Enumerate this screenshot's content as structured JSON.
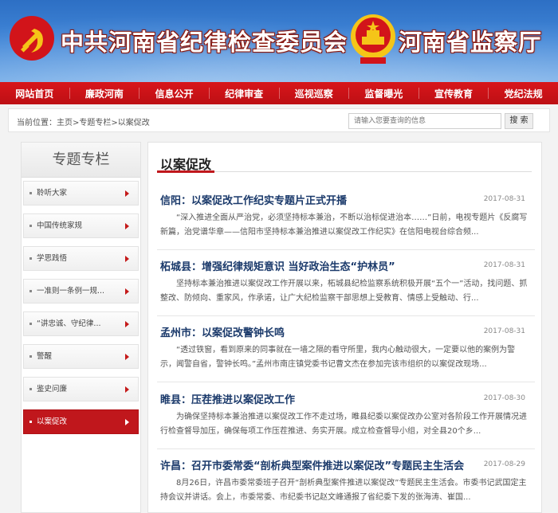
{
  "banner": {
    "title_left": "中共河南省纪律检查委员会",
    "title_right": "河南省监察厅",
    "colors": {
      "sky": "#3f84d6",
      "title_outline": "#8b1a10",
      "emblem_red": "#d2141a",
      "emblem_gold": "#f5c518"
    }
  },
  "nav": {
    "items": [
      "网站首页",
      "廉政河南",
      "信息公开",
      "纪律审查",
      "巡视巡察",
      "监督曝光",
      "宣传教育",
      "党纪法规"
    ],
    "color": "#c9121a"
  },
  "breadcrumb": {
    "label": "当前位置：",
    "path": "主页>专题专栏>以案促改"
  },
  "search": {
    "placeholder": "请输入您要查询的信息",
    "button": "搜 索"
  },
  "sidebar": {
    "heading": "专题专栏",
    "items": [
      "聆听大家",
      "中国传统家规",
      "学思践悟",
      "一准则一条例一规...",
      "“讲忠诚、守纪律...",
      "警醒",
      "鉴史问廉",
      "以案促改"
    ],
    "active_index": 7
  },
  "main": {
    "title": "以案促改",
    "articles": [
      {
        "title": "信阳：以案促改工作纪实专题片正式开播",
        "date": "2017-08-31",
        "summary": "“深入推进全面从严治党，必须坚持标本兼治，不断以治标促进治本……”日前，电视专题片《反腐写新篇，治党谱华章——信阳市坚持标本兼治推进以案促改工作纪实》在信阳电视台综合频..."
      },
      {
        "title": "柘城县：增强纪律规矩意识 当好政治生态“护林员”",
        "date": "2017-08-31",
        "summary": "坚持标本兼治推进以案促改工作开展以来，柘城县纪检监察系统积极开展“五个一”活动，找问题、抓整改、防倾向、重家风，作承诺，让广大纪检监察干部思想上受教育、情感上受触动、行..."
      },
      {
        "title": "孟州市：以案促改警钟长鸣",
        "date": "2017-08-31",
        "summary": "“透过铁窗，看到原来的同事就在一墙之隔的看守所里，我内心触动很大，一定要以他的案例为警示，闻警自省，警钟长鸣。”孟州市南庄镇党委书记曹文杰在参加完该市组织的以案促改现场..."
      },
      {
        "title": "睢县：压茬推进以案促改工作",
        "date": "2017-08-30",
        "summary": "为确保坚持标本兼治推进以案促改工作不走过场，睢县纪委以案促改办公室对各阶段工作开展情况进行检查督导加压，确保每项工作压茬推进、务实开展。成立检查督导小组，对全县20个乡..."
      },
      {
        "title": "许昌：召开市委常委“剖析典型案件推进以案促改”专题民主生活会",
        "date": "2017-08-29",
        "summary": "8月26日，许昌市委常委班子召开“剖析典型案件推进以案促改”专题民主生活会。市委书记武国定主持会议并讲话。会上，市委常委、市纪委书记赵文峰通报了省纪委下发的张海涛、崔国..."
      }
    ]
  }
}
